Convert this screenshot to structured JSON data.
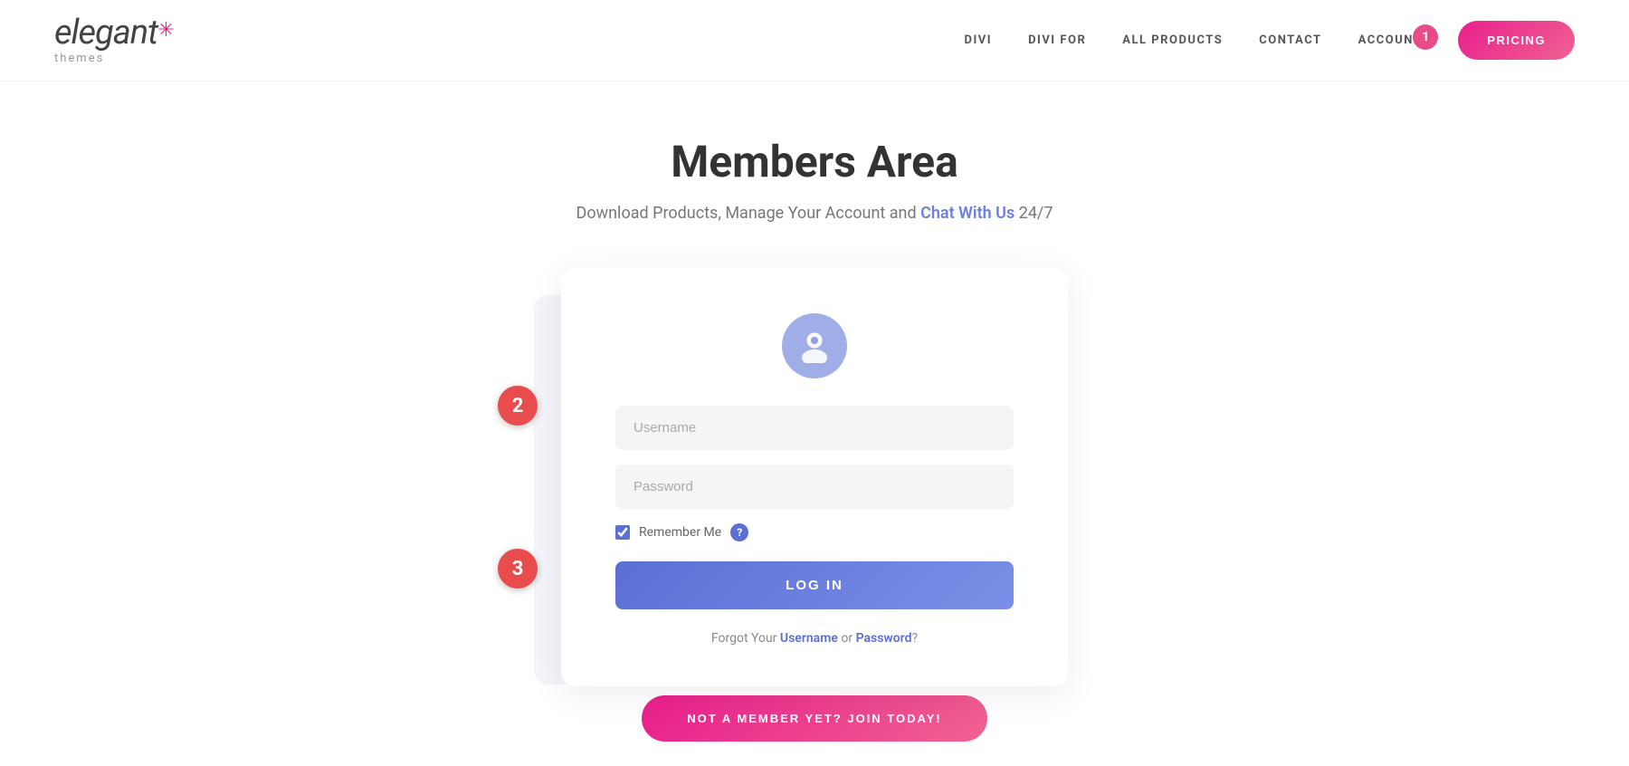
{
  "header": {
    "logo": {
      "brand": "elegant",
      "star": "✳",
      "sub": "themes"
    },
    "nav": {
      "items": [
        {
          "id": "divi",
          "label": "DIVI"
        },
        {
          "id": "divi-for",
          "label": "DIVI FOR"
        },
        {
          "id": "all-products",
          "label": "ALL PRODUCTS"
        },
        {
          "id": "contact",
          "label": "CONTACT"
        },
        {
          "id": "account",
          "label": "ACCOUNT"
        }
      ],
      "account_badge": "1",
      "pricing_button": "PRICING"
    }
  },
  "main": {
    "title": "Members Area",
    "subtitle_before": "Download Products, Manage Your Account and",
    "subtitle_link": "Chat With Us",
    "subtitle_after": " 24/7",
    "login_card": {
      "username_placeholder": "Username",
      "password_placeholder": "Password",
      "remember_me_label": "Remember Me",
      "login_button": "LOG IN",
      "forgot_text_before": "Forgot Your ",
      "forgot_username_link": "Username",
      "forgot_text_middle": " or ",
      "forgot_password_link": "Password",
      "forgot_text_after": "?"
    },
    "join_button": "NOT A MEMBER YET? JOIN TODAY!",
    "annotations": {
      "badge_1": "1",
      "badge_2": "2",
      "badge_3": "3"
    }
  }
}
